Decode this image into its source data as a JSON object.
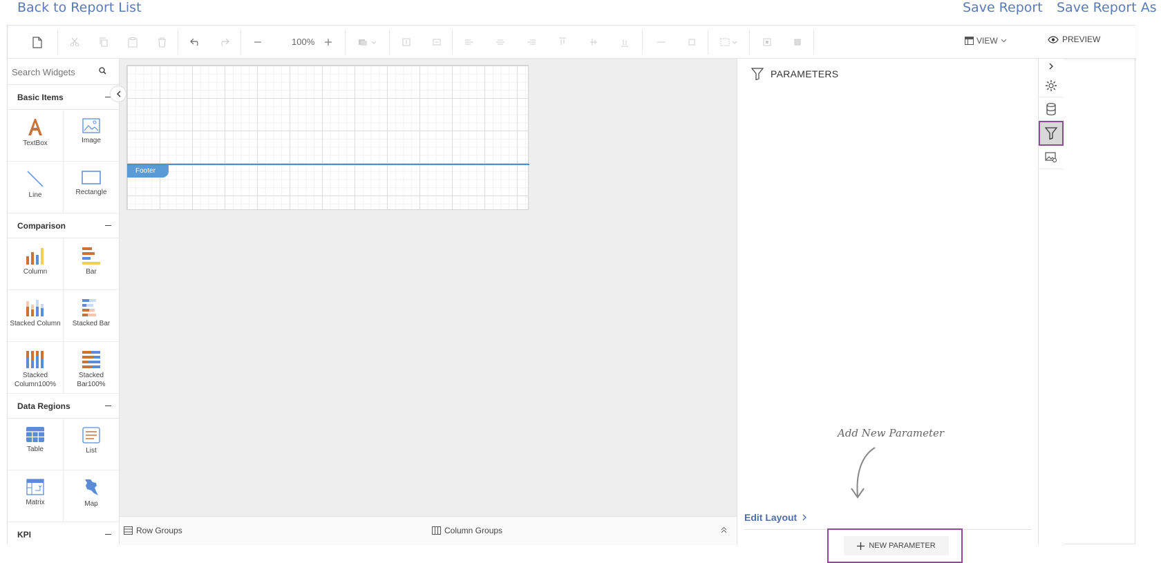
{
  "header": {
    "back_label": "Back to Report List",
    "save_label": "Save Report",
    "save_as_label": "Save Report As"
  },
  "toolbar": {
    "zoom": "100%",
    "view_label": "VIEW",
    "preview_label": "PREVIEW"
  },
  "widgets": {
    "search_placeholder": "Search Widgets",
    "categories": [
      {
        "name": "Basic Items",
        "items": [
          "TextBox",
          "Image",
          "Line",
          "Rectangle"
        ]
      },
      {
        "name": "Comparison",
        "items": [
          "Column",
          "Bar",
          "Stacked Column",
          "Stacked Bar",
          "Stacked Column100%",
          "Stacked Bar100%"
        ]
      },
      {
        "name": "Data Regions",
        "items": [
          "Table",
          "List",
          "Matrix",
          "Map"
        ]
      },
      {
        "name": "KPI",
        "items": []
      }
    ]
  },
  "canvas": {
    "footer_label": "Footer"
  },
  "groups": {
    "row_label": "Row Groups",
    "column_label": "Column Groups"
  },
  "parameters": {
    "title": "PARAMETERS",
    "hint": "Add New Parameter",
    "edit_layout_label": "Edit Layout",
    "new_parameter_label": "NEW PARAMETER"
  },
  "colors": {
    "accent": "#5a7bb5",
    "highlight": "#8e4a94",
    "footer_band": "#5a9bd5"
  }
}
